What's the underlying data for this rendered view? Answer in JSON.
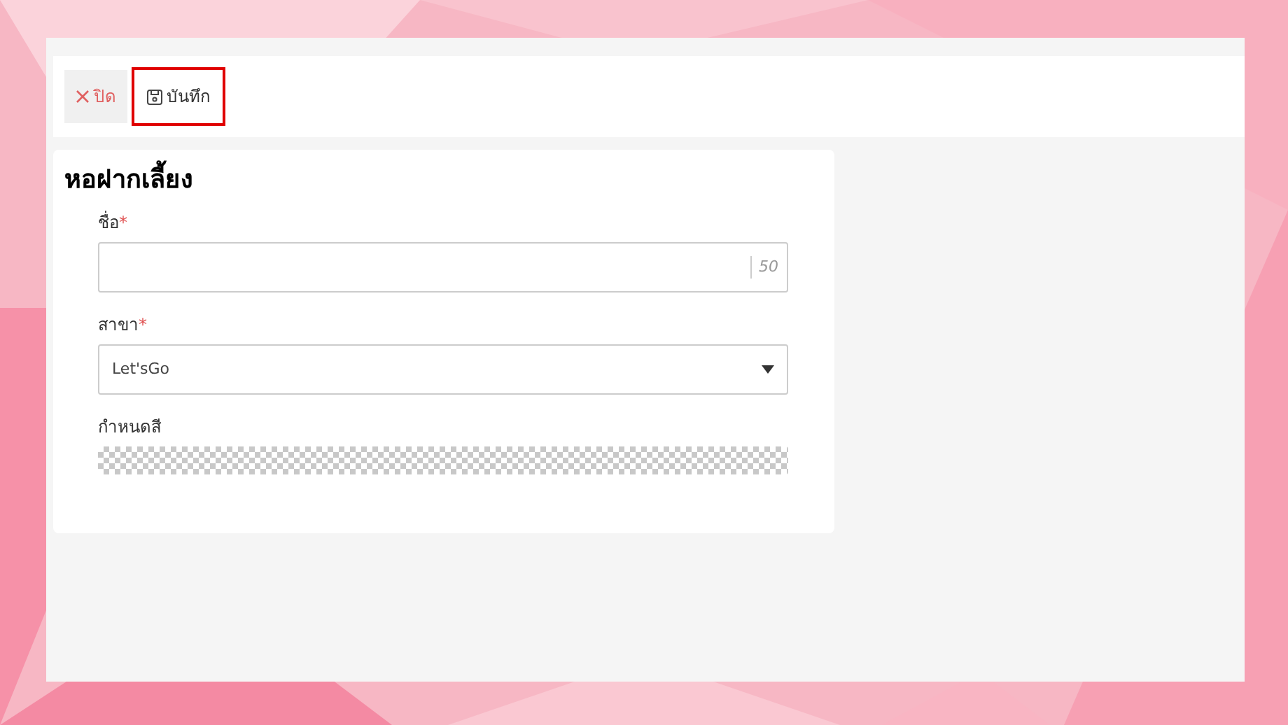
{
  "toolbar": {
    "buttons": [
      {
        "kind": "close",
        "label": "ปิด",
        "highlighted": false
      },
      {
        "kind": "save",
        "label": "บันทึก",
        "highlighted": true
      }
    ]
  },
  "form": {
    "title": "หอฝากเลี้ยง",
    "fields": [
      {
        "kind": "text",
        "label": "ชื่อ",
        "required_mark": "*",
        "counter": "50"
      },
      {
        "kind": "select",
        "label": "สาขา",
        "required_mark": "*",
        "value": "Let'sGo"
      },
      {
        "kind": "color",
        "label": "กำหนดสี"
      }
    ]
  }
}
